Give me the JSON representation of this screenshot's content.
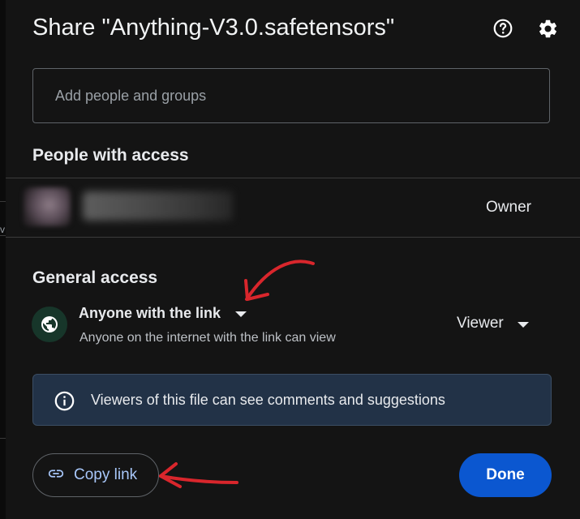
{
  "dialog": {
    "title": "Share \"Anything-V3.0.safetensors\"",
    "help_icon": "help-circle-icon",
    "settings_icon": "gear-icon"
  },
  "add_people": {
    "placeholder": "Add people and groups",
    "value": ""
  },
  "people_with_access": {
    "heading": "People with access",
    "owner": {
      "role": "Owner"
    }
  },
  "general_access": {
    "heading": "General access",
    "icon": "globe-icon",
    "icon_bg": "#17362a",
    "scope_label": "Anyone with the link",
    "description": "Anyone on the internet with the link can view",
    "permission": "Viewer"
  },
  "info_banner": {
    "icon": "info-icon",
    "text": "Viewers of this file can see comments and suggestions",
    "bg": "#223247"
  },
  "actions": {
    "copy_link_label": "Copy link",
    "copy_link_icon": "link-icon",
    "done_label": "Done",
    "primary_color": "#0b57d0",
    "link_color": "#a8c7fa"
  },
  "annotations": {
    "color": "#d9262c"
  },
  "edge": {
    "char": "v"
  }
}
